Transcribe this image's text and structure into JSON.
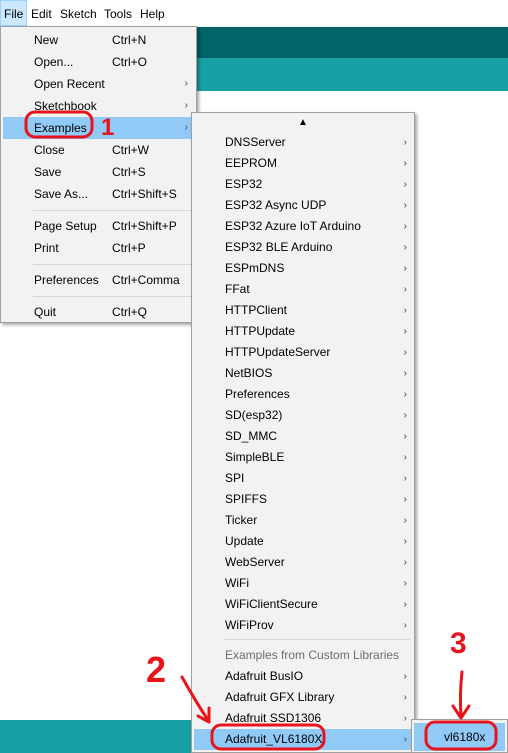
{
  "menubar": {
    "items": [
      {
        "label": "File"
      },
      {
        "label": "Edit"
      },
      {
        "label": "Sketch"
      },
      {
        "label": "Tools"
      },
      {
        "label": "Help"
      }
    ]
  },
  "file_menu": {
    "items": [
      {
        "label": "New",
        "shortcut": "Ctrl+N"
      },
      {
        "label": "Open...",
        "shortcut": "Ctrl+O"
      },
      {
        "label": "Open Recent",
        "submenu": true
      },
      {
        "label": "Sketchbook",
        "submenu": true
      },
      {
        "label": "Examples",
        "submenu": true,
        "highlighted": true
      },
      {
        "label": "Close",
        "shortcut": "Ctrl+W"
      },
      {
        "label": "Save",
        "shortcut": "Ctrl+S"
      },
      {
        "label": "Save As...",
        "shortcut": "Ctrl+Shift+S"
      },
      {
        "label": "Page Setup",
        "shortcut": "Ctrl+Shift+P"
      },
      {
        "label": "Print",
        "shortcut": "Ctrl+P"
      },
      {
        "label": "Preferences",
        "shortcut": "Ctrl+Comma"
      },
      {
        "label": "Quit",
        "shortcut": "Ctrl+Q"
      }
    ]
  },
  "examples_menu": {
    "items": [
      "DNSServer",
      "EEPROM",
      "ESP32",
      "ESP32 Async UDP",
      "ESP32 Azure IoT Arduino",
      "ESP32 BLE Arduino",
      "ESPmDNS",
      "FFat",
      "HTTPClient",
      "HTTPUpdate",
      "HTTPUpdateServer",
      "NetBIOS",
      "Preferences",
      "SD(esp32)",
      "SD_MMC",
      "SimpleBLE",
      "SPI",
      "SPIFFS",
      "Ticker",
      "Update",
      "WebServer",
      "WiFi",
      "WiFiClientSecure",
      "WiFiProv"
    ],
    "custom_header": "Examples from Custom Libraries",
    "custom_items": [
      {
        "label": "Adafruit BusIO"
      },
      {
        "label": "Adafruit GFX Library"
      },
      {
        "label": "Adafruit SSD1306"
      },
      {
        "label": "Adafruit_VL6180X",
        "highlighted": true
      }
    ]
  },
  "sub_menu": {
    "items": [
      "vl6180x"
    ]
  },
  "annotations": {
    "step1": "1",
    "step2": "2",
    "step3": "3",
    "color": "#e8141c"
  },
  "colors": {
    "toolbar": "#006468",
    "tabbar": "#17a1a5",
    "highlight": "#91c9f7",
    "menu_bg": "#f2f2f2"
  }
}
